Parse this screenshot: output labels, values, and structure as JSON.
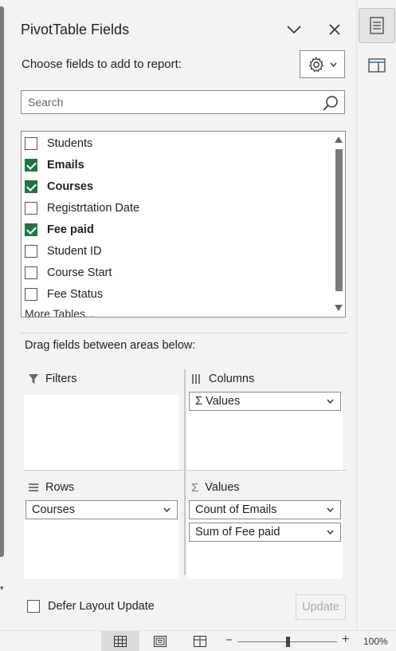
{
  "pane": {
    "title": "PivotTable Fields",
    "choose_label": "Choose fields to add to report:",
    "search_placeholder": "Search",
    "fields": [
      {
        "label": "Students",
        "checked": false
      },
      {
        "label": "Emails",
        "checked": true
      },
      {
        "label": "Courses",
        "checked": true
      },
      {
        "label": "Registrtation Date",
        "checked": false
      },
      {
        "label": "Fee paid",
        "checked": true
      },
      {
        "label": "Student ID",
        "checked": false
      },
      {
        "label": "Course Start",
        "checked": false
      },
      {
        "label": "Fee Status",
        "checked": false
      }
    ],
    "more_tables": "More Tables...",
    "drag_label": "Drag fields between areas below:"
  },
  "areas": {
    "filters": {
      "label": "Filters",
      "items": []
    },
    "columns": {
      "label": "Columns",
      "items": [
        "Σ Values"
      ]
    },
    "rows": {
      "label": "Rows",
      "items": [
        "Courses"
      ]
    },
    "values": {
      "label": "Values",
      "items": [
        "Count of Emails",
        "Sum of Fee paid"
      ]
    }
  },
  "footer": {
    "defer_label": "Defer Layout Update",
    "update_label": "Update"
  },
  "statusbar": {
    "zoom_minus": "−",
    "zoom_plus": "+",
    "zoom_level": "100%",
    "zoom_fraction": 0.5
  },
  "colors": {
    "accent": "#217346"
  }
}
